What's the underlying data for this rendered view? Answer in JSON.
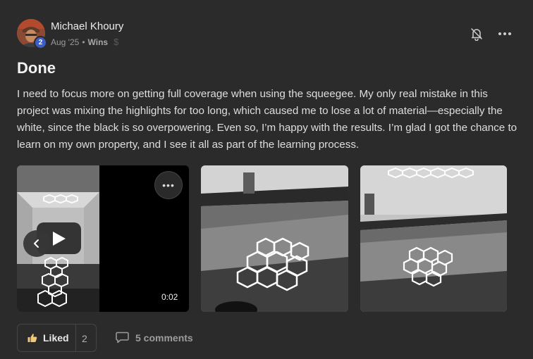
{
  "post": {
    "author": "Michael Khoury",
    "level": "2",
    "date": "Aug '25",
    "dot": "•",
    "category": "Wins",
    "dollar_symbol": "$",
    "title": "Done",
    "body": "I need to focus more on getting full coverage when using the squeegee. My only real mistake in this project was mixing the highlights for too long, which caused me to lose a lot of material—especially the white, since the black is so overpowering. Even so, I’m happy with the results. I’m glad I got the chance to learn on my own property, and I see it all as part of the learning process."
  },
  "media": {
    "video": {
      "duration": "0:02",
      "more_glyph": "•••",
      "play_icon": "play-icon",
      "prev_icon": "chevron-left-icon"
    },
    "images": [
      {
        "name": "garage-floor-photo-1"
      },
      {
        "name": "garage-floor-photo-2"
      }
    ]
  },
  "actions": {
    "like_label": "Liked",
    "like_count": "2",
    "comments_label": "5 comments",
    "icons": [
      "bell-off-icon",
      "more-icon",
      "thumbs-up-icon",
      "comment-icon"
    ]
  },
  "colors": {
    "background": "#2b2b2b",
    "badge": "#3b5ec9",
    "like_thumb": "#f1c77a"
  }
}
